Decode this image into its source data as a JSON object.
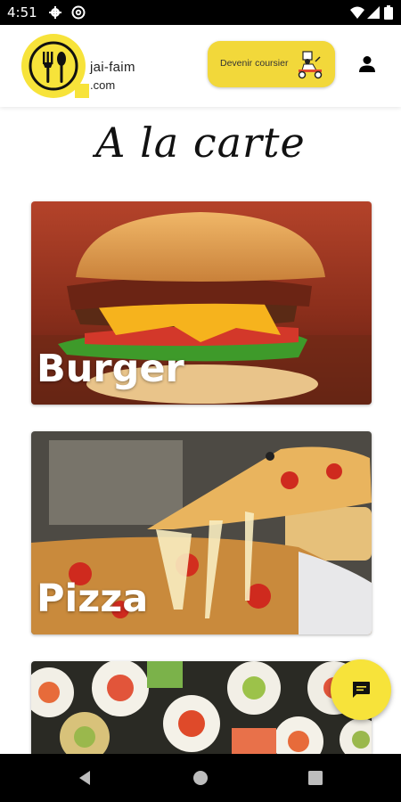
{
  "status_bar": {
    "time": "4:51"
  },
  "header": {
    "logo_line1": "jai-faim",
    "logo_line2": ".com",
    "courier_button_label": "Devenir coursier"
  },
  "page": {
    "title": "A la carte"
  },
  "categories": [
    {
      "label": "Burger"
    },
    {
      "label": "Pizza"
    },
    {
      "label": ""
    }
  ],
  "colors": {
    "accent": "#f7e33a",
    "button": "#f2d83a"
  },
  "icons": [
    "gear-icon",
    "at-icon",
    "wifi-icon",
    "signal-icon",
    "battery-icon",
    "user-icon",
    "chat-icon",
    "back-icon",
    "home-icon",
    "recents-icon"
  ]
}
